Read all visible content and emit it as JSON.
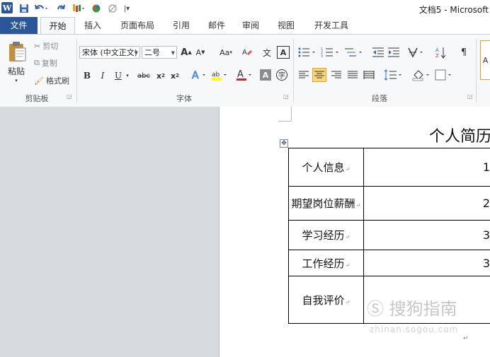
{
  "app": {
    "title": "文档5 - Microsoft",
    "logo_letter": "W"
  },
  "qat": [
    "save-icon",
    "undo-icon",
    "redo-icon",
    "paint-icon",
    "color-icon",
    "no-format-icon",
    "customize-qat-icon"
  ],
  "tabs": [
    {
      "label": "文件",
      "kind": "file"
    },
    {
      "label": "开始",
      "kind": "active"
    },
    {
      "label": "插入"
    },
    {
      "label": "页面布局"
    },
    {
      "label": "引用"
    },
    {
      "label": "邮件"
    },
    {
      "label": "审阅"
    },
    {
      "label": "视图"
    },
    {
      "label": "开发工具"
    }
  ],
  "ribbon": {
    "clipboard": {
      "paste_label": "粘贴",
      "cut_label": "剪切",
      "copy_label": "复制",
      "format_painter_label": "格式刷",
      "group_label": "剪贴板"
    },
    "font": {
      "font_name": "宋体 (中文正文)",
      "font_size": "二号",
      "grow_font": "A",
      "shrink_font": "A",
      "change_case": "Aa",
      "bold": "B",
      "italic": "I",
      "underline": "U",
      "strikethrough": "abc",
      "subscript": "x",
      "superscript": "x",
      "font_color_letter": "A",
      "char_shading": "A",
      "enclosed_char": "字",
      "char_border": "A",
      "phonetic_guide": "文",
      "group_label": "字体"
    },
    "paragraph": {
      "group_label": "段落"
    },
    "styles": {
      "preview": "A"
    }
  },
  "document": {
    "title": "个人简历",
    "rows": [
      {
        "label": "个人信息",
        "value": "1"
      },
      {
        "label": "期望岗位薪酬",
        "value": "2"
      },
      {
        "label": "学习经历",
        "value": "3"
      },
      {
        "label": "工作经历",
        "value": "3"
      },
      {
        "label": "自我评价",
        "value": ""
      }
    ]
  },
  "watermark": {
    "text": "搜狗指南",
    "url": "zhinan.sogou.com"
  }
}
